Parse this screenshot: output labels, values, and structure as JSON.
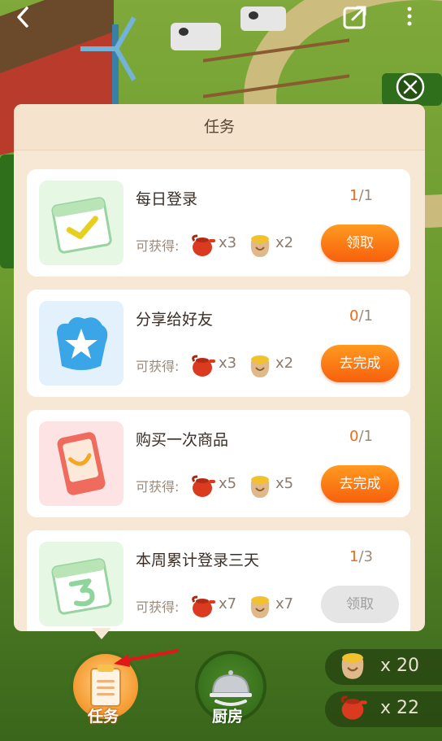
{
  "panel": {
    "title": "任务"
  },
  "tasks": [
    {
      "title": "每日登录",
      "progress_current": "1",
      "progress_total": "/1",
      "reward_label": "可获得:",
      "reward_water": "x3",
      "reward_seed": "x2",
      "button": "领取",
      "button_state": "active",
      "icon": "calendar-check-icon"
    },
    {
      "title": "分享给好友",
      "progress_current": "0",
      "progress_total": "/1",
      "reward_label": "可获得:",
      "reward_water": "x3",
      "reward_seed": "x2",
      "button": "去完成",
      "button_state": "active",
      "icon": "star-cloud-icon"
    },
    {
      "title": "购买一次商品",
      "progress_current": "0",
      "progress_total": "/1",
      "reward_label": "可获得:",
      "reward_water": "x5",
      "reward_seed": "x5",
      "button": "去完成",
      "button_state": "active",
      "icon": "shopping-phone-icon"
    },
    {
      "title": "本周累计登录三天",
      "progress_current": "1",
      "progress_total": "/3",
      "reward_label": "可获得:",
      "reward_water": "x7",
      "reward_seed": "x7",
      "button": "领取",
      "button_state": "disabled",
      "icon": "calendar-three-icon"
    }
  ],
  "bottom_nav": {
    "task_label": "任务",
    "kitchen_label": "厨房"
  },
  "inventory": {
    "seed_qty": "x 20",
    "water_qty": "x 22"
  },
  "colors": {
    "accent": "#f7600d",
    "progress_current": "#f06a1c",
    "panel_bg": "#f7e8d6"
  }
}
